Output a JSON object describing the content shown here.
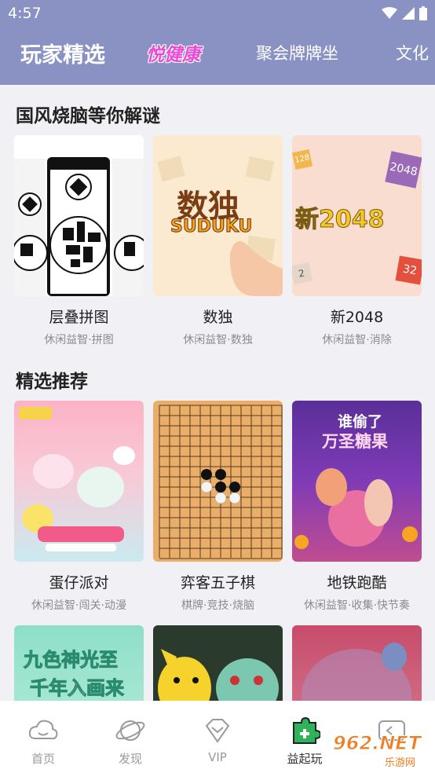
{
  "status_bar": {
    "time": "4:57"
  },
  "tabs": [
    {
      "label": "玩家精选",
      "active": true
    },
    {
      "label": "悦健康",
      "style": "logo"
    },
    {
      "label": "聚会牌牌坐"
    },
    {
      "label": "文化"
    }
  ],
  "sections": [
    {
      "title": "国风烧脑等你解谜",
      "games": [
        {
          "name": "层叠拼图",
          "tags": "休闲益智·拼图"
        },
        {
          "name": "数独",
          "tags": "休闲益智·数独",
          "art_text": [
            "数独",
            "SUDUKU"
          ]
        },
        {
          "name": "新2048",
          "tags": "休闲益智·消除",
          "art_text": [
            "新2048",
            "128",
            "2048",
            "2",
            "32"
          ]
        }
      ]
    },
    {
      "title": "精选推荐",
      "games": [
        {
          "name": "蛋仔派对",
          "tags": "休闲益智·闯关·动漫"
        },
        {
          "name": "弈客五子棋",
          "tags": "棋牌·竞技·烧脑"
        },
        {
          "name": "地铁跑酷",
          "tags": "休闲益智·收集·快节奏",
          "art_text": [
            "谁偷了",
            "万圣糖果"
          ]
        }
      ]
    },
    {
      "games": [
        {
          "art_text": [
            "九色神光至",
            "千年入画来"
          ]
        },
        {},
        {}
      ]
    }
  ],
  "bottom_nav": [
    {
      "label": "首页",
      "icon": "cloud-home-icon"
    },
    {
      "label": "发现",
      "icon": "planet-icon"
    },
    {
      "label": "VIP",
      "icon": "diamond-icon"
    },
    {
      "label": "益起玩",
      "icon": "puzzle-icon",
      "active": true
    },
    {
      "label": "",
      "icon": "game-icon"
    }
  ],
  "watermark": {
    "text": "962.NET",
    "sub": "乐游网"
  },
  "colors": {
    "header": "#8a92c4",
    "background": "#f1f1f5",
    "accent_green": "#2fb35a"
  }
}
